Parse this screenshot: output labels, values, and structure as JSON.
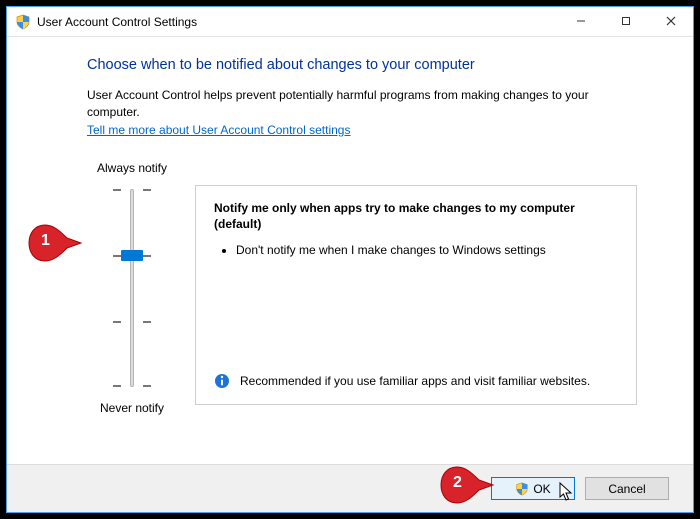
{
  "window": {
    "title": "User Account Control Settings"
  },
  "content": {
    "heading": "Choose when to be notified about changes to your computer",
    "description": "User Account Control helps prevent potentially harmful programs from making changes to your computer.",
    "link": "Tell me more about User Account Control settings"
  },
  "slider": {
    "top_label": "Always notify",
    "bottom_label": "Never notify",
    "levels": 4,
    "selected_level": 2
  },
  "panel": {
    "title": "Notify me only when apps try to make changes to my computer (default)",
    "bullets": [
      "Don't notify me when I make changes to Windows settings"
    ],
    "recommend": "Recommended if you use familiar apps and visit familiar websites."
  },
  "footer": {
    "ok_label": "OK",
    "cancel_label": "Cancel"
  },
  "callouts": {
    "one": "1",
    "two": "2"
  }
}
